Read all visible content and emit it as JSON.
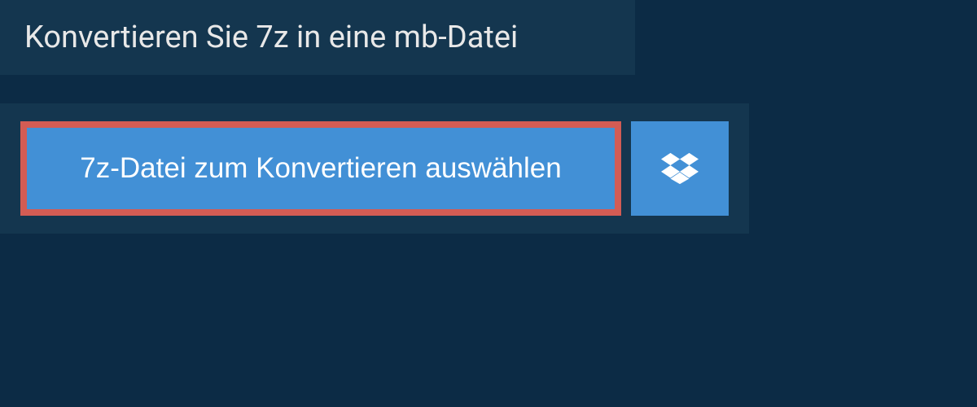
{
  "header": {
    "title": "Konvertieren Sie 7z in eine mb-Datei"
  },
  "upload": {
    "select_file_label": "7z-Datei zum Konvertieren auswählen",
    "cloud_provider": "dropbox"
  },
  "colors": {
    "background": "#0c2b45",
    "panel": "#14364f",
    "button": "#4290d6",
    "highlight_border": "#d35c54",
    "text_light": "#e8e8e8",
    "text_white": "#ffffff"
  }
}
